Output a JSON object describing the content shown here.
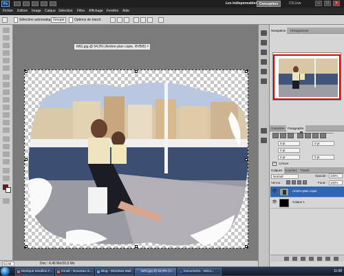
{
  "titlebar": {
    "app_logo": "Ps",
    "workspace_label": "Les indispensables",
    "workspace_button": "Conception",
    "cs_live": "CS Live",
    "minimize": "–",
    "maximize": "□",
    "close": "×"
  },
  "menu": [
    "Fichier",
    "Edition",
    "Image",
    "Calque",
    "Sélection",
    "Filtre",
    "Affichage",
    "Fenêtre",
    "Aide"
  ],
  "options": {
    "auto_select_label": "Sélection automatique :",
    "auto_select_value": "Groupe",
    "show_transform": "Options de transf."
  },
  "document": {
    "tab_title": "IMG.jpg @ 54,9% (Arrière-plan copie, RVB/8)",
    "tab_close": "×"
  },
  "status": {
    "zoom": "54,88 %",
    "doc_info": "Doc : 4,46 Mo/10,5 Mo"
  },
  "panels": {
    "nav_tabs": [
      "Navigation",
      "Histogramme"
    ],
    "char_tabs": [
      "Caractère",
      "Paragraphe"
    ],
    "paragraph_fields": [
      "0 pt",
      "0 pt",
      "0 pt",
      "0 pt",
      "0 pt"
    ],
    "hyphenation": "Césure",
    "layers_tabs": [
      "Calques",
      "Couches",
      "Tracés"
    ],
    "blend_mode": "Normal",
    "opacity_label": "Opacité :",
    "opacity_value": "100%",
    "lock_label": "Verrou :",
    "fill_label": "Fond :",
    "fill_value": "100%",
    "layers": [
      {
        "name": "Arrière-plan copie",
        "selected": true
      },
      {
        "name": "Calque 1",
        "selected": false
      }
    ]
  },
  "taskbar": {
    "tasks": [
      "Monique Mouillon F...",
      "Gmail - Nouveau m...",
      "Blog - Windows Mail",
      "IMG.jpg @ 54,9% (A...",
      "Document1 - Micro..."
    ],
    "clock": "11:08"
  },
  "colors": {
    "foreground": "#7b1414",
    "background": "#ffffff",
    "selected_layer": "#2f66b3",
    "nav_frame": "#dd0000"
  }
}
